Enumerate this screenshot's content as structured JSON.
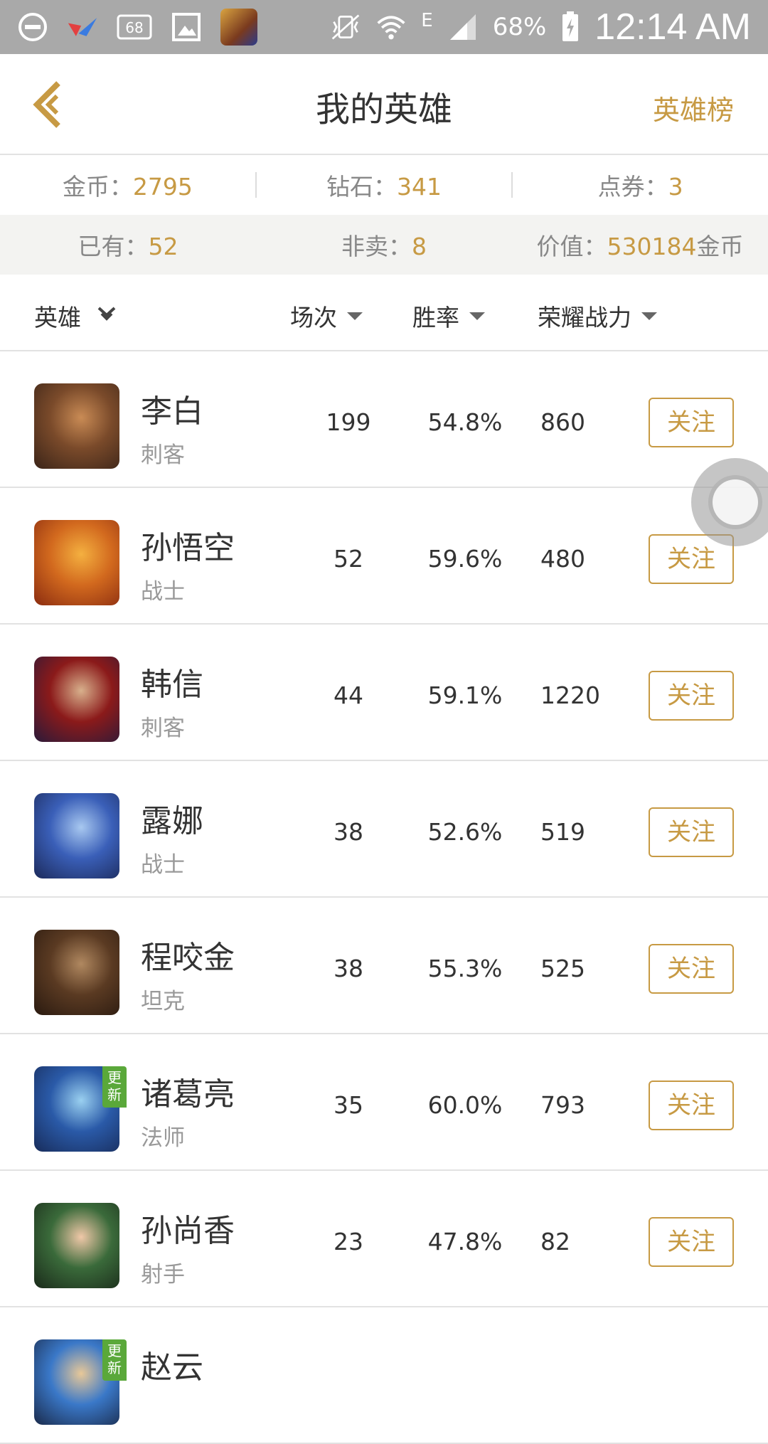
{
  "status_bar": {
    "notif_count": "68",
    "network": "E",
    "battery": "68%",
    "time": "12:14 AM",
    "icons": [
      "do-not-disturb-icon",
      "app-logo-icon",
      "notification-count-icon",
      "image-icon",
      "game-icon",
      "vibrate-icon",
      "wifi-icon",
      "signal-icon",
      "battery-charging-icon"
    ]
  },
  "header": {
    "title": "我的英雄",
    "right_link": "英雄榜",
    "back_icon": "back-chevron-icon"
  },
  "currency": [
    {
      "label": "金币：",
      "value": "2795"
    },
    {
      "label": "钻石：",
      "value": "341"
    },
    {
      "label": "点券：",
      "value": "3"
    }
  ],
  "summary": [
    {
      "label": "已有：",
      "value": "52",
      "suffix": ""
    },
    {
      "label": "非卖：",
      "value": "8",
      "suffix": ""
    },
    {
      "label": "价值：",
      "value": "530184",
      "suffix": "金币"
    }
  ],
  "columns": {
    "hero": "英雄",
    "games": "场次",
    "win_rate": "胜率",
    "power": "荣耀战力"
  },
  "heroes": [
    {
      "name": "李白",
      "role": "刺客",
      "games": "199",
      "win_rate": "54.8%",
      "power": "860",
      "follow": "关注",
      "badge": "",
      "colors": [
        "#7a4a2a",
        "#c98b55",
        "#3a2418"
      ]
    },
    {
      "name": "孙悟空",
      "role": "战士",
      "games": "52",
      "win_rate": "59.6%",
      "power": "480",
      "follow": "关注",
      "badge": "",
      "colors": [
        "#d2691e",
        "#f4b040",
        "#8a2c10"
      ]
    },
    {
      "name": "韩信",
      "role": "刺客",
      "games": "44",
      "win_rate": "59.1%",
      "power": "1220",
      "follow": "关注",
      "badge": "",
      "colors": [
        "#8b1a1a",
        "#d8b08c",
        "#2a1a3a"
      ]
    },
    {
      "name": "露娜",
      "role": "战士",
      "games": "38",
      "win_rate": "52.6%",
      "power": "519",
      "follow": "关注",
      "badge": "",
      "colors": [
        "#3a5fb8",
        "#a8c8f0",
        "#1c2a5a"
      ]
    },
    {
      "name": "程咬金",
      "role": "坦克",
      "games": "38",
      "win_rate": "55.3%",
      "power": "525",
      "follow": "关注",
      "badge": "",
      "colors": [
        "#5a3a22",
        "#b08860",
        "#2a1a10"
      ]
    },
    {
      "name": "诸葛亮",
      "role": "法师",
      "games": "35",
      "win_rate": "60.0%",
      "power": "793",
      "follow": "关注",
      "badge": "更新",
      "colors": [
        "#2a5aa8",
        "#9ad0f0",
        "#182c5a"
      ]
    },
    {
      "name": "孙尚香",
      "role": "射手",
      "games": "23",
      "win_rate": "47.8%",
      "power": "82",
      "follow": "关注",
      "badge": "",
      "colors": [
        "#3a6a3a",
        "#f0c8a8",
        "#1a2a1a"
      ]
    },
    {
      "name": "赵云",
      "role": "",
      "games": "",
      "win_rate": "",
      "power": "",
      "follow": "",
      "badge": "更新",
      "colors": [
        "#3a78c8",
        "#e8c898",
        "#1a2a4a"
      ]
    }
  ]
}
